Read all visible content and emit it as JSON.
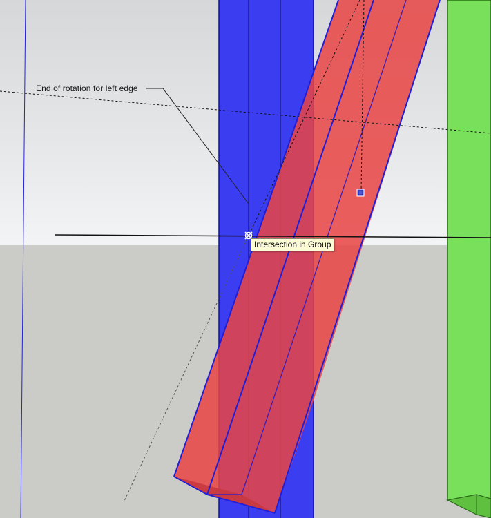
{
  "scene": {
    "callout_text": "End of rotation for left edge",
    "tooltip_text": "Intersection in Group",
    "inference_marker": "x-cursor-icon",
    "grip_marker": "rotation-grip-icon"
  },
  "colors": {
    "blue_post_fill": "#3b3df0",
    "blue_post_edge": "#1a1ac8",
    "red_post_fill": "#e84040",
    "red_post_edge": "#1f1fd8",
    "green_post_fill": "#78e05a",
    "green_post_edge": "#2a7a1a",
    "sky": "#e4e6e8",
    "ground": "#cbcbc7",
    "tooltip_bg": "#fdfbd6"
  }
}
